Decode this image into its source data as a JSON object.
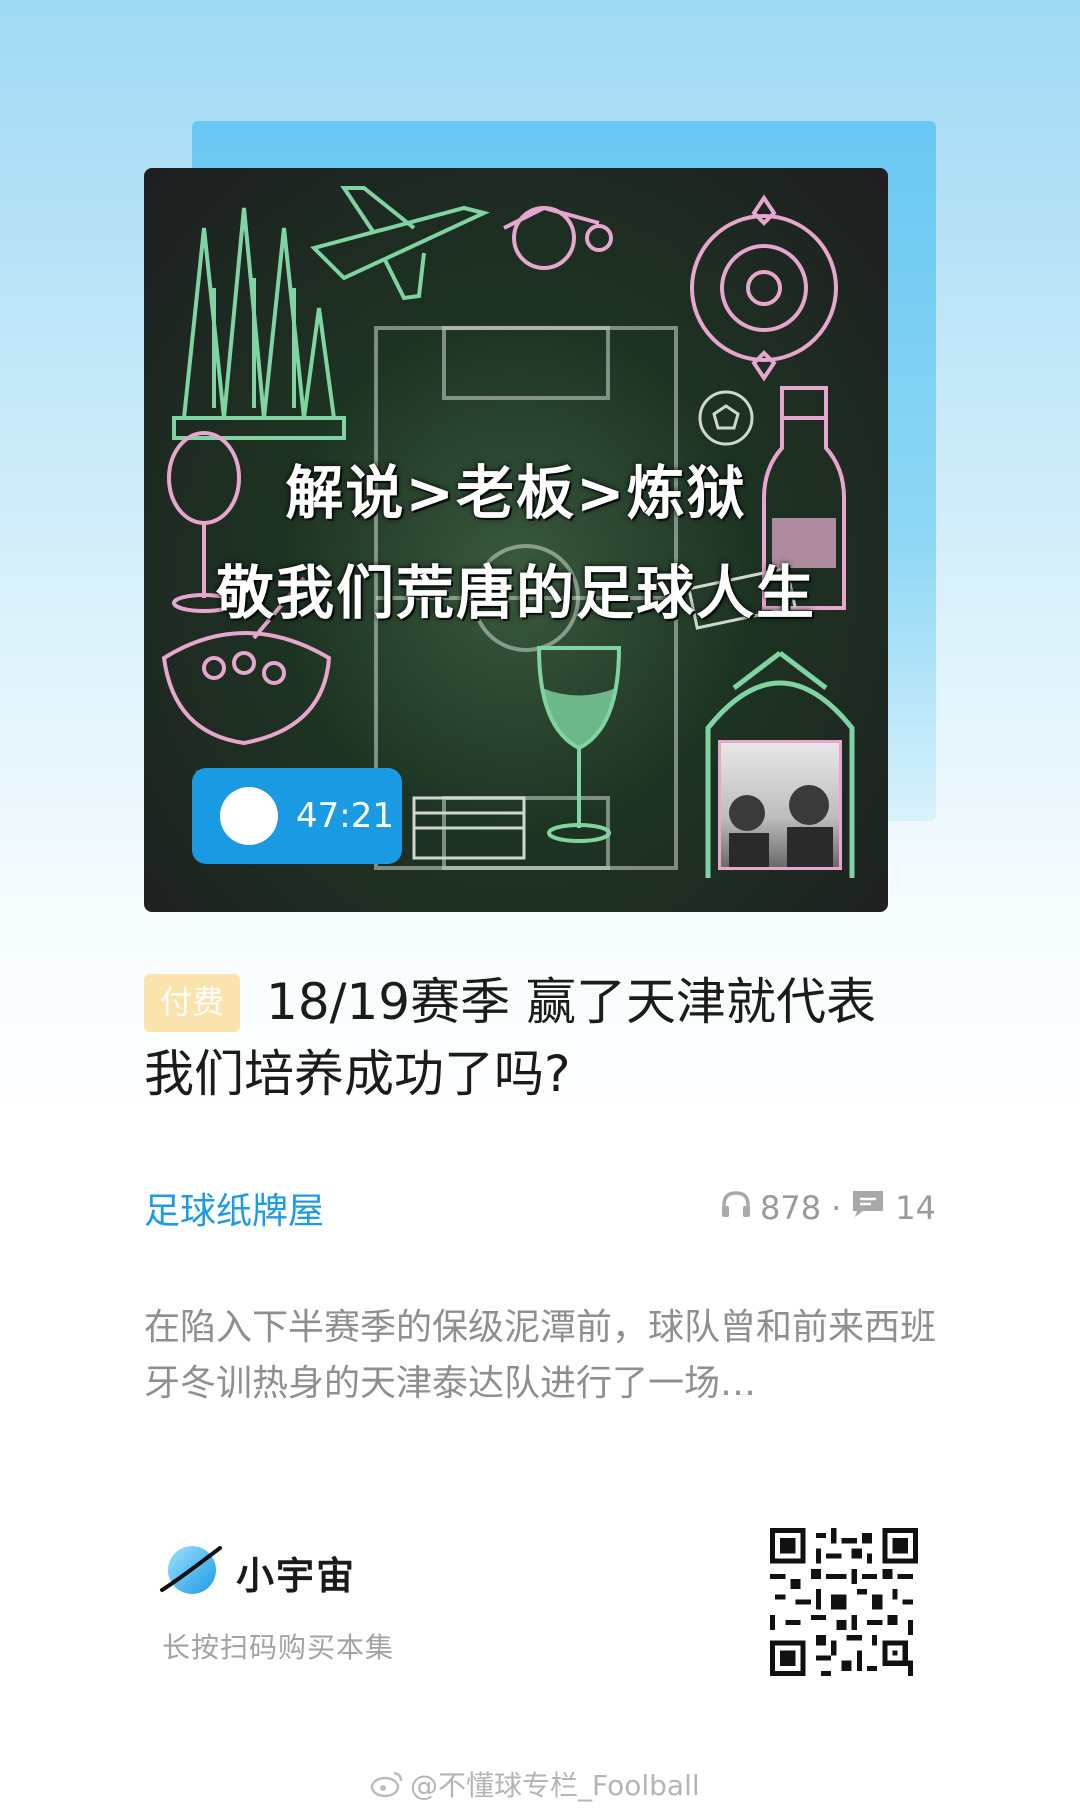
{
  "cover": {
    "title_line1": "解说>老板>炼狱",
    "title_line2": "敬我们荒唐的足球人生",
    "duration": "47:21"
  },
  "episode": {
    "badge": "付费",
    "title": "18/19赛季 赢了天津就代表我们培养成功了吗?"
  },
  "meta": {
    "channel": "足球纸牌屋",
    "listens": "878",
    "separator": "·",
    "comments": "14"
  },
  "summary": "在陷入下半赛季的保级泥潭前，球队曾和前来西班牙冬训热身的天津泰达队进行了一场…",
  "footer": {
    "brand": "小宇宙",
    "scan_hint": "长按扫码购买本集",
    "watermark": "@不懂球专栏_Foolball"
  },
  "colors": {
    "accent": "#1b9ae4",
    "badge_bg": "#fbe3ad",
    "cover_green": "#7fd4a1",
    "cover_pink": "#e7a6cd"
  }
}
